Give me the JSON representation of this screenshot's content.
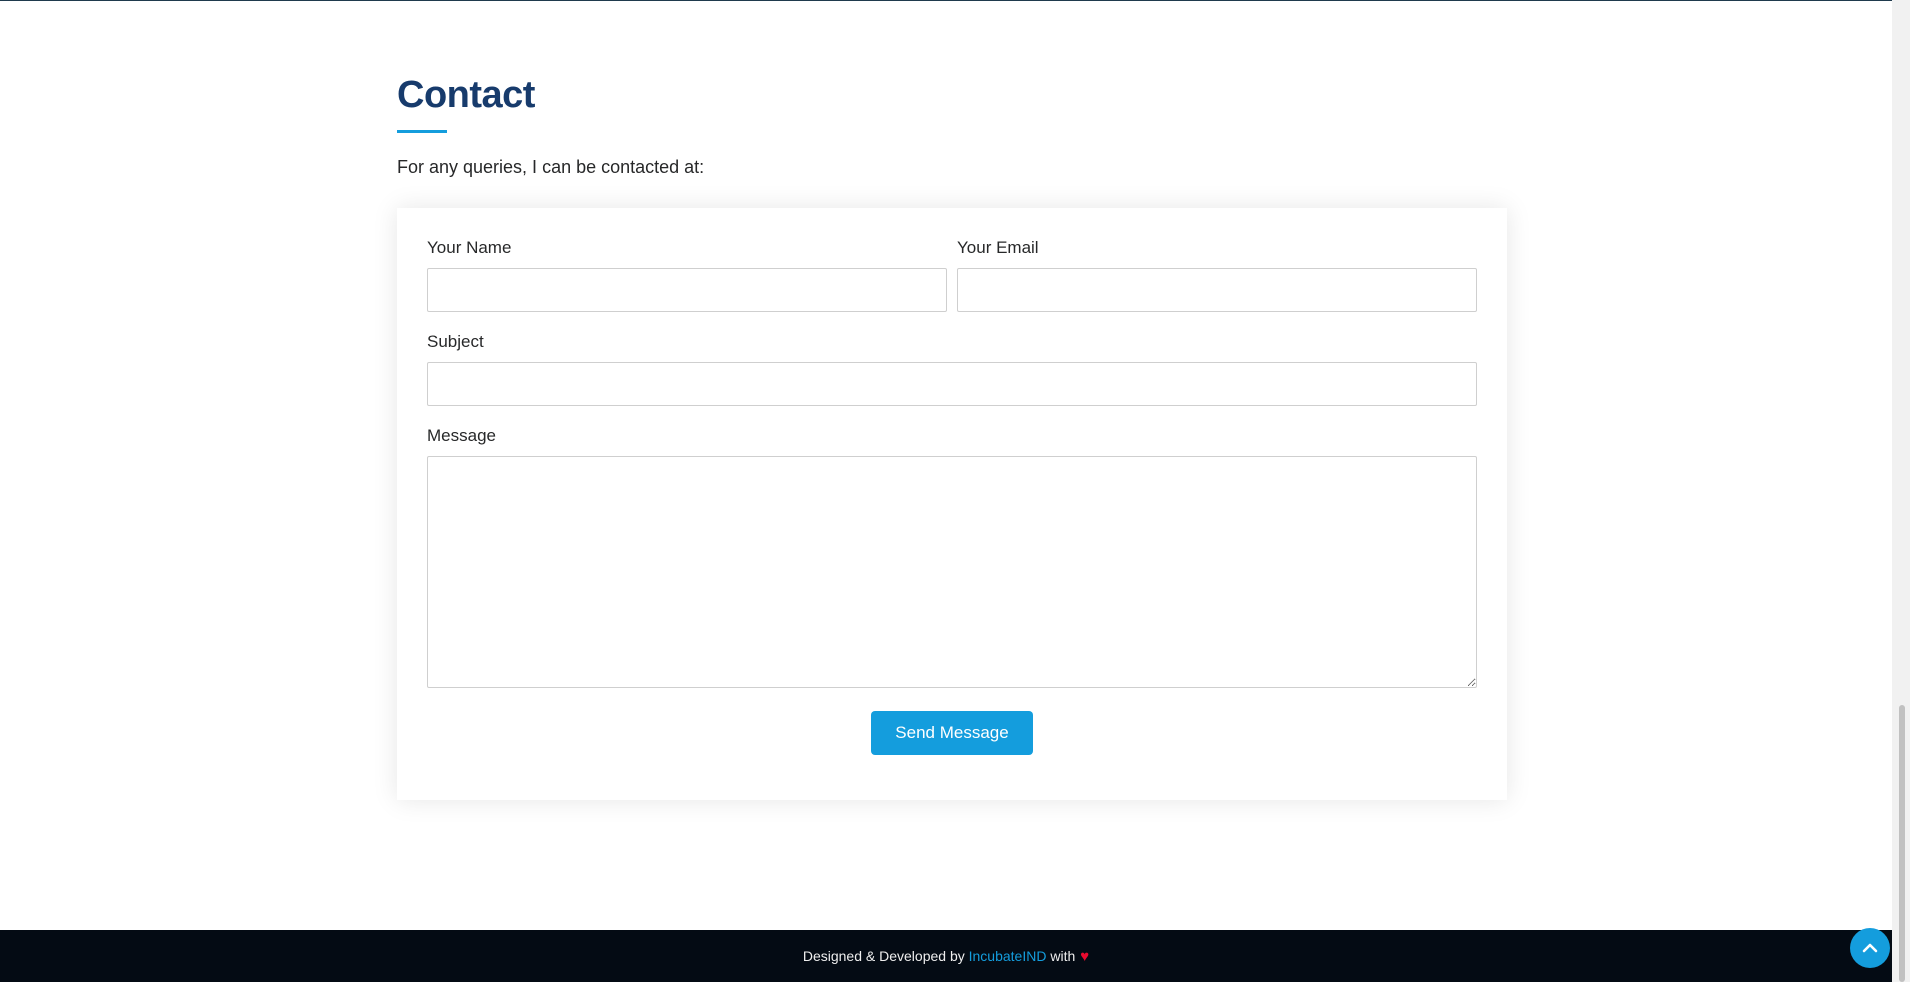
{
  "contact": {
    "title": "Contact",
    "intro": "For any queries, I can be contacted at:"
  },
  "form": {
    "name_label": "Your Name",
    "name_value": "",
    "email_label": "Your Email",
    "email_value": "",
    "subject_label": "Subject",
    "subject_value": "",
    "message_label": "Message",
    "message_value": "",
    "submit_label": "Send Message"
  },
  "footer": {
    "prefix": "Designed & Developed by ",
    "link_text": "IncubateIND",
    "suffix": " with"
  },
  "icons": {
    "heart": "heart-icon",
    "back_to_top": "chevron-up-icon"
  },
  "colors": {
    "accent": "#149ddd",
    "title": "#173b6c",
    "footer_bg": "#040b14",
    "heart": "#e80a2e"
  }
}
